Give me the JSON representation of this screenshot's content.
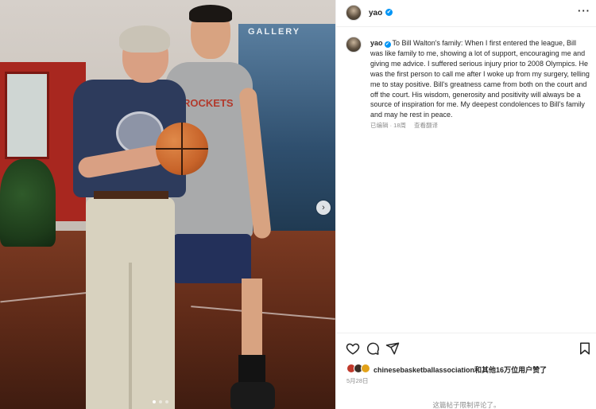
{
  "post": {
    "image": {
      "wall_text": "GALLERY",
      "jersey_text": "ROCKETS",
      "carousel_next": "›"
    },
    "header": {
      "username": "yao",
      "verified_mark": "✔",
      "more": "···"
    },
    "caption": {
      "username": "yao",
      "verified_mark": "✔",
      "text": "To Bill Walton's family: When I first entered the league, Bill was like family to me, showing a lot of support, encouraging me and giving me advice. I suffered serious injury prior to 2008 Olympics. He was the first person to call me after I woke up from my surgery, telling me to stay positive. Bill's greatness came from both on the court and off the court. His wisdom, generosity and positivity will always be a source of inspiration for me. My deepest condolences to Bill's family and may he rest in peace."
    },
    "meta": {
      "edited": "已编辑 · 18周",
      "translate": "查看翻译"
    },
    "likes": {
      "text": "chinesebasketballassociation和其他16万位用户赞了"
    },
    "date": "5月28日",
    "comments_restricted": "这篇帖子限制评论了。"
  },
  "colors": {
    "verified_blue": "#0095f6",
    "muted_text": "#8e8e8e",
    "primary_text": "#262626"
  },
  "icons": [
    "heart-icon",
    "comment-icon",
    "share-icon",
    "bookmark-icon",
    "more-icon",
    "verified-icon",
    "chevron-right-icon"
  ]
}
